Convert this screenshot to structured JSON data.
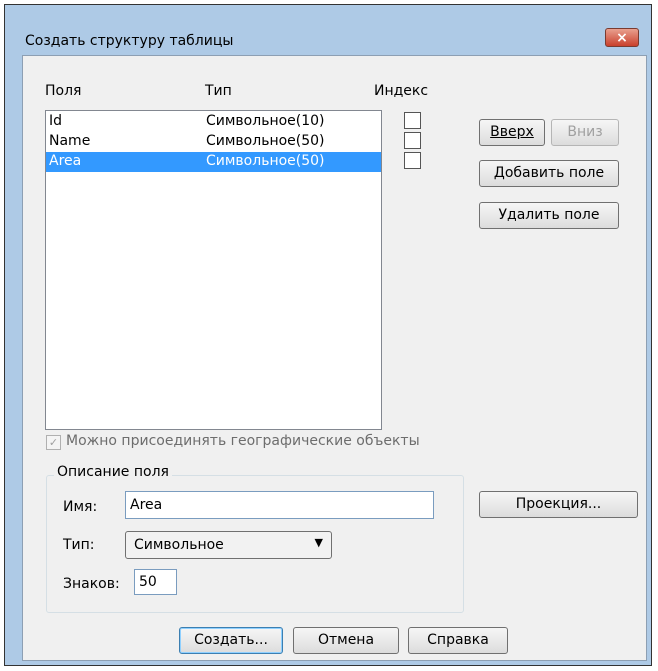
{
  "window": {
    "title": "Создать структуру таблицы",
    "close_label": "×"
  },
  "fields_list": {
    "headers": {
      "fields": "Поля",
      "type": "Тип",
      "index": "Индекс"
    },
    "rows": [
      {
        "name": "Id",
        "type": "Символьное(10)",
        "indexed": false,
        "selected": false
      },
      {
        "name": "Name",
        "type": "Символьное(50)",
        "indexed": false,
        "selected": false
      },
      {
        "name": "Area",
        "type": "Символьное(50)",
        "indexed": false,
        "selected": true
      }
    ]
  },
  "side_buttons": {
    "up": "Вверх",
    "down": "Вниз",
    "add": "Добавить поле",
    "remove": "Удалить поле",
    "projection": "Проекция..."
  },
  "geo_checkbox": {
    "label": "Можно присоединять географические объекты",
    "checked": true,
    "disabled": true
  },
  "field_description": {
    "group_label": "Описание поля",
    "name_label": "Имя:",
    "name_value": "Area",
    "type_label": "Тип:",
    "type_value": "Символьное",
    "chars_label": "Знаков:",
    "chars_value": "50"
  },
  "bottom_buttons": {
    "create": "Создать...",
    "cancel": "Отмена",
    "help": "Справка"
  }
}
